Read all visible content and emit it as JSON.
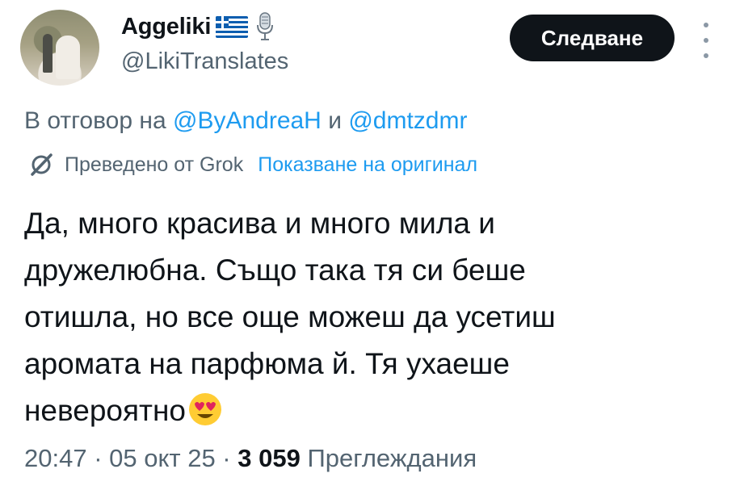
{
  "author": {
    "name": "Aggeliki",
    "handle": "@LikiTranslates",
    "flag_icon": "greece-flag-icon",
    "badge_icon": "microphone-icon"
  },
  "follow_button": {
    "label": "Следване"
  },
  "more_icon": "more-vertical-icon",
  "reply": {
    "prefix": "В отговор на",
    "mention1": "@ByAndreaH",
    "conjunction": "и",
    "mention2": "@dmtzdmr"
  },
  "translation": {
    "icon": "grok-icon",
    "label": "Преведено от Grok",
    "show_original": "Показване на оригинал"
  },
  "tweet": {
    "lines": [
      "Да, много красива и много мила и",
      "дружелюбна. Също така тя си беше",
      "отишла, но все още можеш да усетиш",
      "аромата на парфюма й. Тя ухаеше",
      "невероятно"
    ],
    "emoji": "heart-eyes-emoji"
  },
  "meta": {
    "time": "20:47",
    "separator1": " · ",
    "date": "05 окт 25",
    "separator2": " · ",
    "views_count": "3 059",
    "views_label": "Преглеждания"
  },
  "colors": {
    "text": "#0f1419",
    "secondary": "#536471",
    "link": "#1d9bf0",
    "button_bg": "#0f1419"
  }
}
